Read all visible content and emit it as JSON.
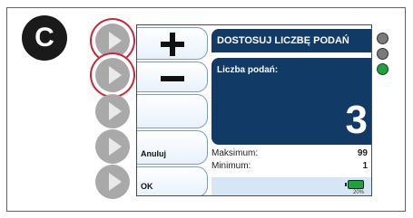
{
  "badge_label": "C",
  "screen": {
    "title": "DOSTOSUJ LICZBĘ PODAŃ",
    "value_label": "Liczba podań:",
    "value": "3",
    "max_label": "Maksimum:",
    "max_value": "99",
    "min_label": "Minimum:",
    "min_value": "1",
    "battery_pct": "20%"
  },
  "softkeys": {
    "cancel_label": "Anuluj",
    "ok_label": "OK"
  },
  "colors": {
    "accent_ring": "#c8283a",
    "screen_blue": "#123a66",
    "led_off": "#7a7a7a",
    "led_on": "#1ea33a",
    "side_button": "#a9a9a9"
  },
  "icons": {
    "side_button": "play-triangle-icon",
    "increment": "plus-icon",
    "decrement": "minus-icon",
    "battery": "battery-icon"
  },
  "leds": [
    {
      "name": "led-1",
      "state": "off"
    },
    {
      "name": "led-2",
      "state": "off"
    },
    {
      "name": "led-3",
      "state": "on"
    }
  ]
}
